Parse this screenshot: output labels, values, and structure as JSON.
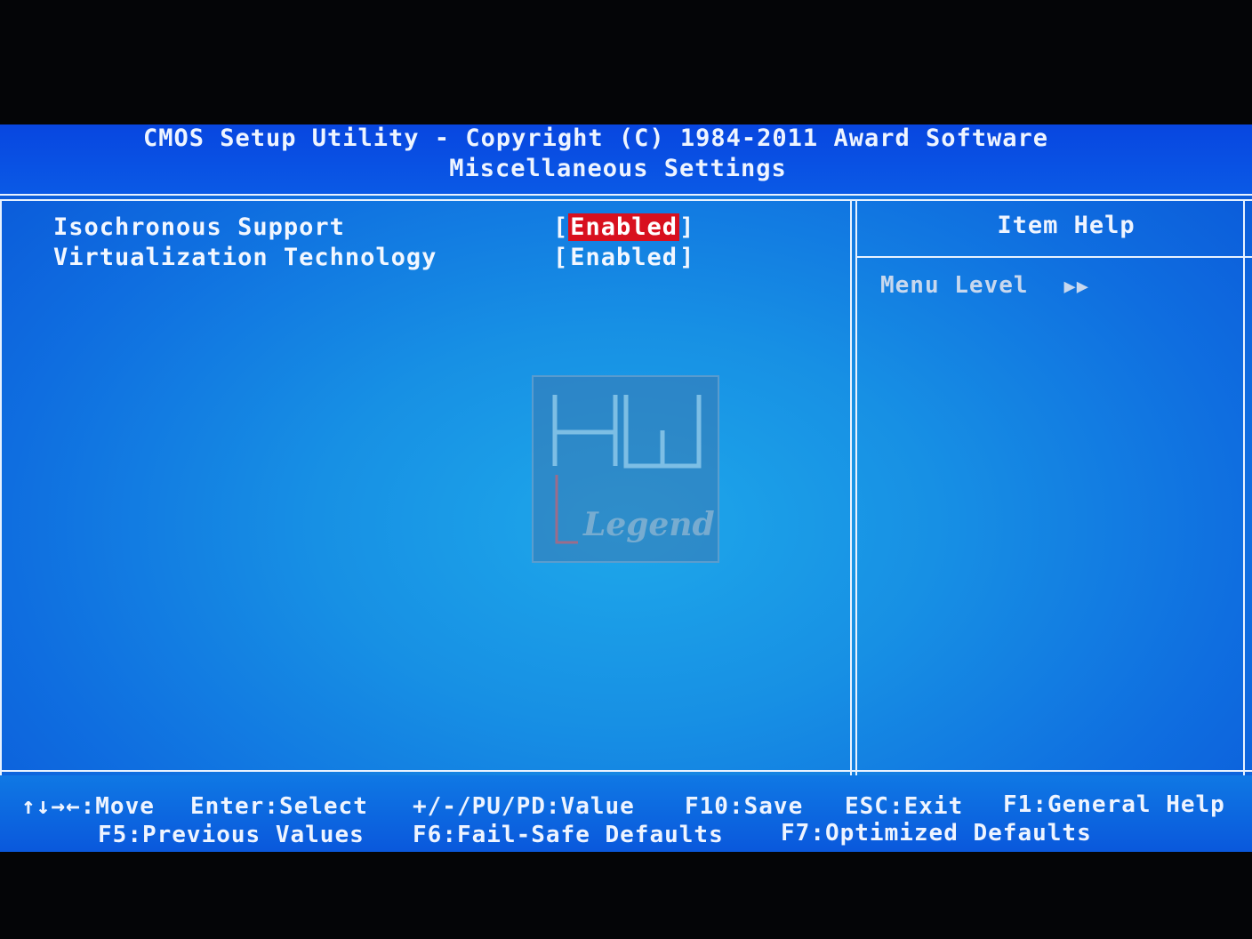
{
  "header": {
    "title": "CMOS Setup Utility - Copyright (C) 1984-2011 Award Software",
    "subtitle": "Miscellaneous Settings"
  },
  "settings": [
    {
      "label": "Isochronous Support",
      "value": "Enabled",
      "selected": true
    },
    {
      "label": "Virtualization Technology",
      "value": "Enabled",
      "selected": false
    }
  ],
  "help": {
    "title": "Item Help",
    "menu_level_label": "Menu Level",
    "menu_level_arrows": "▶▶"
  },
  "watermark": {
    "line1": "HW",
    "line2": "Legend"
  },
  "footer": {
    "row1": [
      {
        "key": "↑↓→←",
        "action": "Move"
      },
      {
        "key": "Enter",
        "action": "Select"
      },
      {
        "key": "+/-/PU/PD",
        "action": "Value"
      },
      {
        "key": "F10",
        "action": "Save"
      },
      {
        "key": "ESC",
        "action": "Exit"
      },
      {
        "key": "F1",
        "action": "General Help"
      }
    ],
    "row2": [
      {
        "key": "F5",
        "action": "Previous Values"
      },
      {
        "key": "F6",
        "action": "Fail-Safe Defaults"
      },
      {
        "key": "F7",
        "action": "Optimized Defaults"
      }
    ]
  },
  "colors": {
    "background": "#1790e4",
    "header": "#0846e0",
    "text": "#f2f7ff",
    "highlight": "#d8101e"
  }
}
